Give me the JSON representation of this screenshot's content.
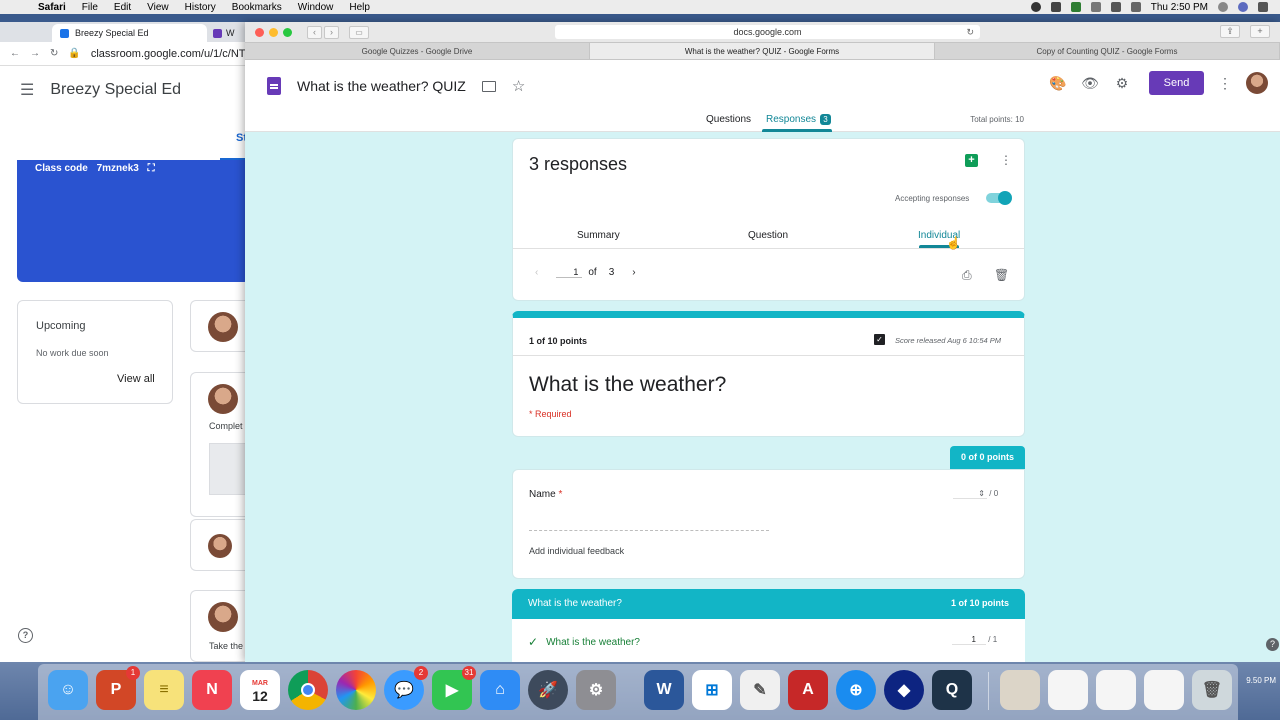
{
  "menubar": {
    "app": "Safari",
    "items": [
      "File",
      "Edit",
      "View",
      "History",
      "Bookmarks",
      "Window",
      "Help"
    ],
    "clock": "Thu 2:50 PM"
  },
  "classroom": {
    "tab_title": "Breezy Special Ed",
    "tab2_title": "W",
    "url": "classroom.google.com/u/1/c/NTM",
    "title": "Breezy Special Ed",
    "stream_tab": "St",
    "class_code_label": "Class code",
    "class_code": "7mznek3",
    "upcoming_title": "Upcoming",
    "upcoming_sub": "No work due soon",
    "view_all": "View all",
    "post_text_1": "Complet",
    "post_text_2": "Take the"
  },
  "safari": {
    "address": "docs.google.com",
    "tabs": [
      "Google Quizzes - Google Drive",
      "What is the weather? QUIZ - Google Forms",
      "Copy of Counting QUIZ - Google Forms"
    ]
  },
  "forms": {
    "doc_title": "What is the weather? QUIZ",
    "send_label": "Send",
    "tab_questions": "Questions",
    "tab_responses": "Responses",
    "responses_badge": "3",
    "total_points": "Total points: 10",
    "responses_count": "3 responses",
    "accepting_label": "Accepting responses",
    "accepting": true,
    "view_tabs": [
      "Summary",
      "Question",
      "Individual"
    ],
    "pager": {
      "current": "1",
      "of_label": "of",
      "total": "3"
    },
    "score": {
      "points": "1 of 10 points",
      "released": "Score released Aug 6 10:54 PM"
    },
    "quiz_title": "What is the weather?",
    "required_label": "* Required",
    "name_section": {
      "points_chip": "0 of 0 points",
      "label": "Name",
      "required_star": "*",
      "score_sep": "/",
      "score_max": "0",
      "feedback": "Add individual feedback"
    },
    "question_section": {
      "title": "What is the weather?",
      "points": "1 of 10 points",
      "row_label": "What is the weather?",
      "score_value": "1",
      "score_sep": "/",
      "score_max": "1"
    }
  },
  "dock": {
    "calendar_month": "MAR",
    "calendar_day": "12",
    "badges": {
      "powerpoint": "1",
      "messages": "2",
      "facetime": "31"
    },
    "clock": "9.50 PM"
  },
  "colors": {
    "teal": "#12b5c6",
    "teal_dark": "#128797",
    "purple": "#673ab7",
    "bg_light": "#d4f3f5"
  }
}
